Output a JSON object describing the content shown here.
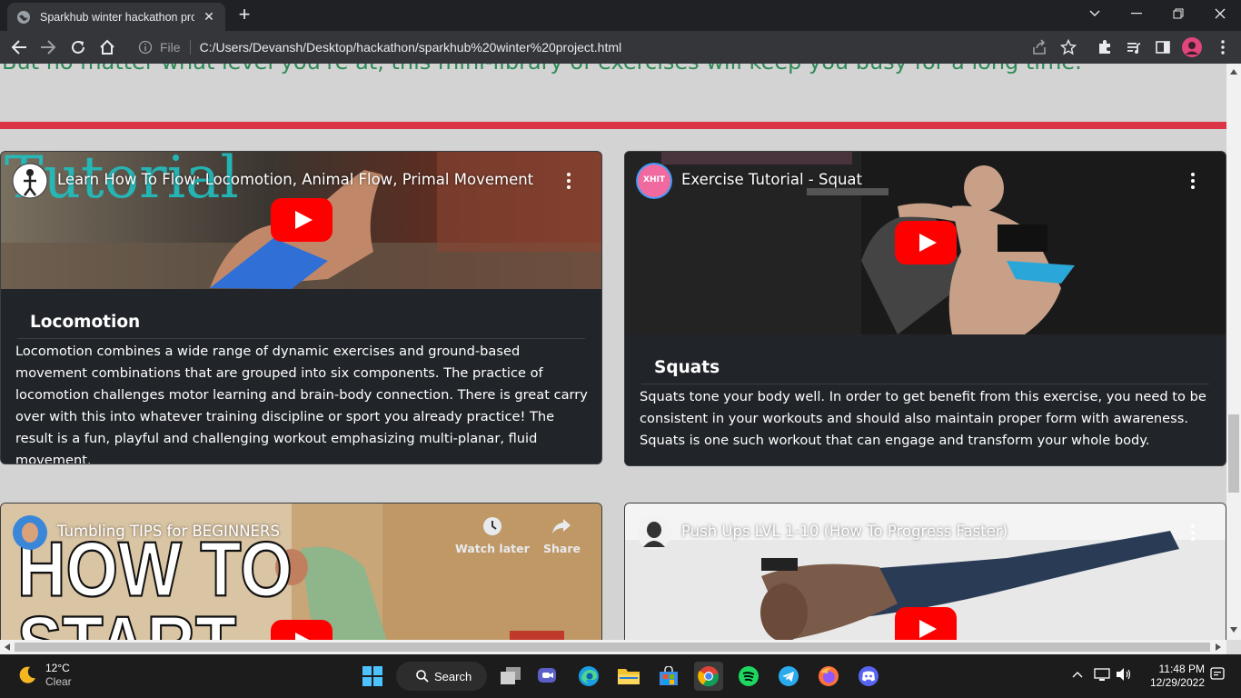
{
  "browser": {
    "tab_title": "Sparkhub winter hackathon proje",
    "close_symbol": "✕",
    "new_tab_symbol": "+",
    "omnibox": {
      "scheme_label": "File",
      "url": "C:/Users/Devansh/Desktop/hackathon/sparkhub%20winter%20project.html"
    }
  },
  "page": {
    "intro_text": "But no matter what level you're at, this mini-library of exercises will keep you busy for a long time.",
    "accent_color": "#dc3545",
    "intro_color": "#2e8b57",
    "cards": [
      {
        "video_title": "Learn How To Flow: Locomotion, Animal Flow, Primal Movement",
        "overlay_word": "Tutorial",
        "title": "Locomotion",
        "text": "Locomotion combines a wide range of dynamic exercises and ground-based movement combinations that are grouped into six components. The practice of locomotion challenges motor learning and brain-body connection. There is great carry over with this into whatever training discipline or sport you already practice! The result is a fun, playful and challenging workout emphasizing multi-planar, fluid movement."
      },
      {
        "video_title": "Exercise Tutorial - Squat",
        "channel_badge": "XHIT",
        "title": "Squats",
        "text": "Squats tone your body well. In order to get benefit from this exercise, you need to be consistent in your workouts and should also maintain proper form with awareness. Squats is one such workout that can engage and transform your whole body."
      },
      {
        "video_title": "Tumbling TIPS for BEGINNERS",
        "thumb_text_1": "HOW TO",
        "thumb_text_2": "START",
        "watch_later": "Watch later",
        "share": "Share"
      },
      {
        "video_title": "Push Ups LVL 1-10 (How To Progress Faster)"
      }
    ]
  },
  "taskbar": {
    "weather_temp": "12°C",
    "weather_cond": "Clear",
    "search_label": "Search",
    "time": "11:48 PM",
    "date": "12/29/2022"
  }
}
